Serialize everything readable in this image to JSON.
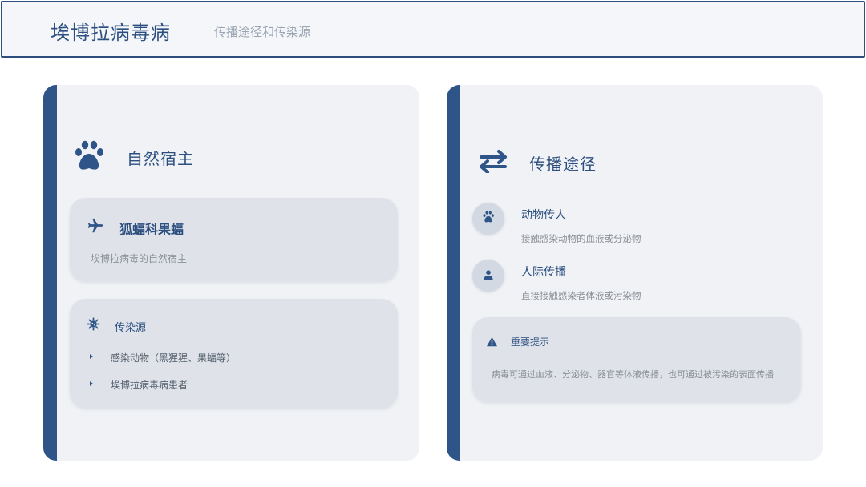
{
  "header": {
    "title": "埃博拉病毒病",
    "subtitle": "传播途径和传染源"
  },
  "left_panel": {
    "title": "自然宿主",
    "title_icon": "paw-icon",
    "host_card": {
      "icon": "plane-icon",
      "title": "狐蝠科果蝠",
      "description": "埃博拉病毒的自然宿主"
    },
    "source_card": {
      "icon": "virus-icon",
      "title": "传染源",
      "items": [
        "感染动物（黑猩猩、果蝠等）",
        "埃博拉病毒病患者"
      ]
    }
  },
  "right_panel": {
    "title": "传播途径",
    "title_icon": "exchange-arrows-icon",
    "routes": [
      {
        "icon": "paw-icon",
        "title": "动物传人",
        "description": "接触感染动物的血液或分泌物"
      },
      {
        "icon": "person-icon",
        "title": "人际传播",
        "description": "直接接触感染者体液或污染物"
      }
    ],
    "note": {
      "icon": "warning-icon",
      "title": "重要提示",
      "text": "病毒可通过血液、分泌物、器官等体液传播，也可通过被污染的表面传播"
    }
  },
  "colors": {
    "primary": "#2e5488",
    "panel_bg": "#f0f2f5",
    "card_bg": "#dfe3e9",
    "muted_text": "#8a8f96"
  }
}
